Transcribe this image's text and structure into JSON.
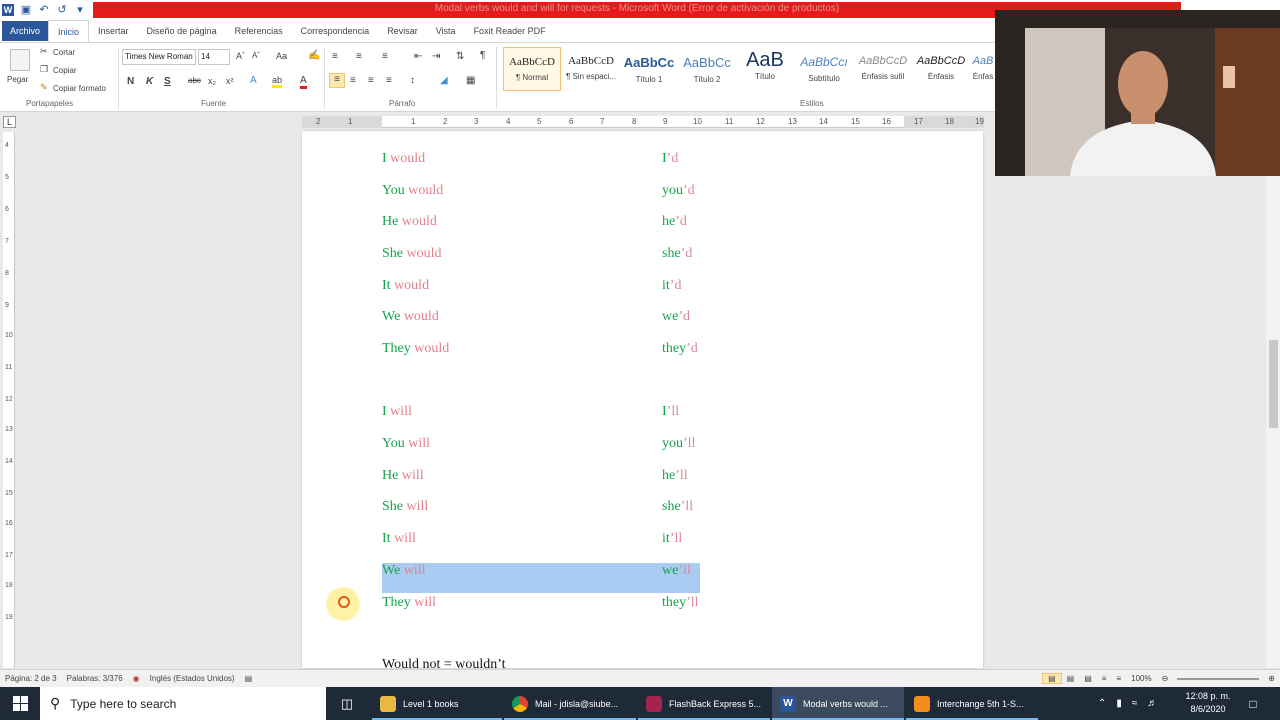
{
  "window": {
    "title": "Modal verbs would and will for requests - Microsoft Word (Error de activación de productos)"
  },
  "tabs": [
    "Archivo",
    "Inicio",
    "Insertar",
    "Diseño de página",
    "Referencias",
    "Correspondencia",
    "Revisar",
    "Vista",
    "Foxit Reader PDF"
  ],
  "ribbon": {
    "clipboard": {
      "paste": "Pegar",
      "cut": "Cortar",
      "copy": "Copiar",
      "format_painter": "Copiar formato",
      "label": "Portapapeles"
    },
    "font": {
      "family": "Times New Roman",
      "size": "14",
      "label": "Fuente"
    },
    "paragraph": {
      "label": "Párrafo"
    },
    "styles": {
      "label": "Estilos",
      "items": [
        {
          "sample": "AaBbCcD",
          "name": "¶ Normal"
        },
        {
          "sample": "AaBbCcD",
          "name": "¶ Sin espaci..."
        },
        {
          "sample": "AaBbCc",
          "name": "Título 1"
        },
        {
          "sample": "AaBbCc",
          "name": "Título 2"
        },
        {
          "sample": "AaB",
          "name": "Título"
        },
        {
          "sample": "AaBbCcı",
          "name": "Subtítulo"
        },
        {
          "sample": "AaBbCcD",
          "name": "Énfasis sutil"
        },
        {
          "sample": "AaBbCcD",
          "name": "Énfasis"
        },
        {
          "sample": "AaB",
          "name": "Énfas"
        }
      ]
    }
  },
  "ruler_numbers": [
    "2",
    "1",
    "1",
    "2",
    "3",
    "4",
    "5",
    "6",
    "7",
    "8",
    "9",
    "10",
    "11",
    "12",
    "13",
    "14",
    "15",
    "16",
    "17",
    "18",
    "19"
  ],
  "document": {
    "would_rows": [
      {
        "pronoun": "I",
        "verb": "would",
        "contraction_pron": "I",
        "contraction_suffix": "’d"
      },
      {
        "pronoun": "You",
        "verb": "would",
        "contraction_pron": "you",
        "contraction_suffix": "’d"
      },
      {
        "pronoun": "He",
        "verb": "would",
        "contraction_pron": "he",
        "contraction_suffix": "’d"
      },
      {
        "pronoun": "She",
        "verb": "would",
        "contraction_pron": "she",
        "contraction_suffix": "’d"
      },
      {
        "pronoun": "It",
        "verb": "would",
        "contraction_pron": "it",
        "contraction_suffix": "’d"
      },
      {
        "pronoun": "We",
        "verb": "would",
        "contraction_pron": "we",
        "contraction_suffix": "’d"
      },
      {
        "pronoun": "They",
        "verb": "would",
        "contraction_pron": "they",
        "contraction_suffix": "’d"
      }
    ],
    "will_rows": [
      {
        "pronoun": "I",
        "verb": "will",
        "contraction_pron": "I",
        "contraction_suffix": "’ll"
      },
      {
        "pronoun": "You",
        "verb": "will",
        "contraction_pron": "you",
        "contraction_suffix": "’ll"
      },
      {
        "pronoun": "He",
        "verb": "will",
        "contraction_pron": "he",
        "contraction_suffix": "’ll"
      },
      {
        "pronoun": "She",
        "verb": "will",
        "contraction_pron": "she",
        "contraction_suffix": "’ll"
      },
      {
        "pronoun": "It",
        "verb": "will",
        "contraction_pron": "it",
        "contraction_suffix": "’ll"
      },
      {
        "pronoun": "We",
        "verb": "will",
        "contraction_pron": "we",
        "contraction_suffix": "’ll"
      },
      {
        "pronoun": "They",
        "verb": "will",
        "contraction_pron": "they",
        "contraction_suffix": "’ll"
      }
    ],
    "selected_row": "We will",
    "next_heading": "Would not = wouldn’t"
  },
  "status": {
    "page": "Página: 2 de 3",
    "words": "Palabras: 3/376",
    "language": "Inglés (Estados Unidos)",
    "zoom": "100%"
  },
  "taskbar": {
    "search_placeholder": "Type here to search",
    "apps": [
      {
        "label": "Level 1 books",
        "icon": "folder-icon"
      },
      {
        "label": "Mail - jdisla@siube...",
        "icon": "chrome-icon"
      },
      {
        "label": "FlashBack Express 5...",
        "icon": "flashback-icon"
      },
      {
        "label": "Modal verbs would ...",
        "icon": "word-icon"
      },
      {
        "label": "Interchange 5th 1-S...",
        "icon": "app-icon"
      }
    ],
    "time": "12:08 p. m.",
    "date": "8/6/2020"
  },
  "colors": {
    "pronoun": "#16a34a",
    "verb": "#e0808a",
    "selection": "#a9cdf2",
    "word_blue": "#2b579a",
    "title_red": "#e51b1b"
  }
}
